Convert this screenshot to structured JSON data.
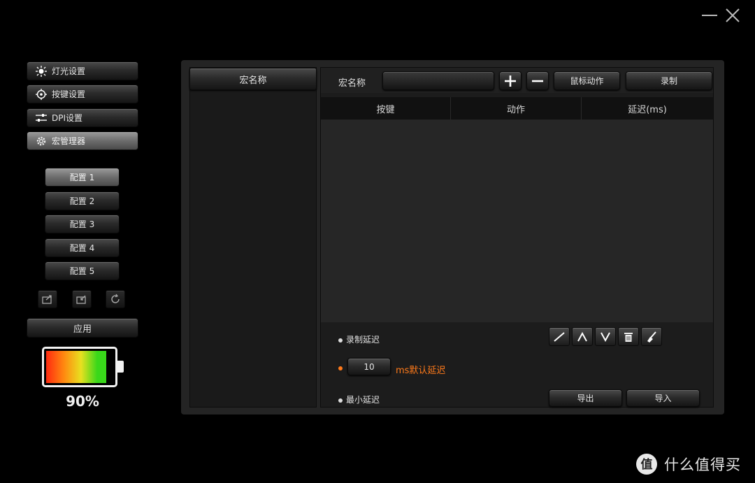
{
  "window": {
    "minimize_icon": "minimize-icon",
    "close_icon": "close-icon"
  },
  "sidebar": {
    "nav": [
      {
        "label": "灯光设置",
        "icon": "sun-icon"
      },
      {
        "label": "按键设置",
        "icon": "crosshair-icon"
      },
      {
        "label": "DPI设置",
        "icon": "sliders-icon"
      },
      {
        "label": "宏管理器",
        "icon": "gear-icon",
        "active": true
      }
    ],
    "profiles": [
      {
        "label": "配置 1",
        "active": true
      },
      {
        "label": "配置 2"
      },
      {
        "label": "配置 3"
      },
      {
        "label": "配置 4"
      },
      {
        "label": "配置 5"
      }
    ],
    "profile_actions": [
      "export-profile-icon",
      "import-profile-icon",
      "reset-icon"
    ],
    "apply_label": "应用",
    "battery": {
      "level": 0.9,
      "text": "90%"
    }
  },
  "macro_list": {
    "header": "宏名称"
  },
  "editor": {
    "name_label": "宏名称",
    "name_value": "",
    "add_icon": "plus-icon",
    "remove_icon": "minus-icon",
    "mouse_action_label": "鼠标动作",
    "record_label": "录制",
    "table_headers": [
      "按键",
      "动作",
      "延迟(ms)"
    ],
    "rows": []
  },
  "options": {
    "record_delay_label": "录制延迟",
    "default_delay_value": "10",
    "default_delay_label": "ms默认延迟",
    "min_delay_label": "最小延迟",
    "tools": [
      "edit-icon",
      "move-up-icon",
      "move-down-icon",
      "delete-icon",
      "clear-icon"
    ],
    "export_label": "导出",
    "import_label": "导入"
  },
  "watermark": {
    "text": "什么值得买",
    "logo": "smzdm-logo-icon"
  },
  "colors": {
    "background": "#000000",
    "accent": "#ff7a1a",
    "battery_red": "#ff2a10",
    "battery_green": "#39d81a"
  }
}
